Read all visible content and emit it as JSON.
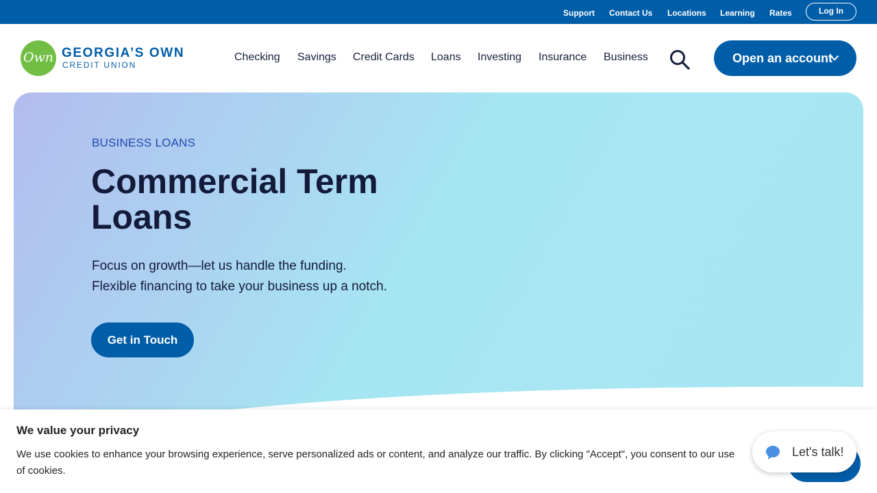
{
  "utility_bar": {
    "links": [
      "Support",
      "Contact Us",
      "Locations",
      "Learning",
      "Rates"
    ],
    "login_label": "Log In"
  },
  "header": {
    "logo": {
      "mark": "Own",
      "name": "GEORGIA’S OWN",
      "subname": "CREDIT UNION"
    },
    "nav": [
      "Checking",
      "Savings",
      "Credit Cards",
      "Loans",
      "Investing",
      "Insurance",
      "Business"
    ],
    "search_icon": "search-icon",
    "open_account_label": "Open an account",
    "open_account_icon": "chevron-down-icon"
  },
  "hero": {
    "eyebrow": "BUSINESS LOANS",
    "title": "Commercial Term Loans",
    "subtitle_line1": "Focus on growth—let us handle the funding.",
    "subtitle_line2": "Flexible financing to take your business up a notch.",
    "cta_label": "Get in Touch"
  },
  "cookie_banner": {
    "title": "We value your privacy",
    "text": "We use cookies to enhance your browsing experience, serve personalized ads or content, and analyze our traffic. By clicking \"Accept\", you consent to our use of cookies."
  },
  "chat_widget": {
    "label": "Let's talk!",
    "icon": "chat-bubble-icon"
  },
  "colors": {
    "brand_blue": "#005da8",
    "logo_green": "#72be44",
    "heading_navy": "#131a3a",
    "eyebrow_blue": "#1e49b0"
  }
}
